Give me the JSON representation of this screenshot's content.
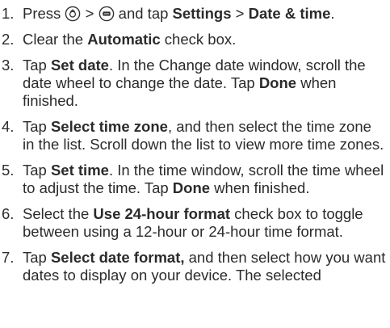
{
  "steps": [
    {
      "num": "1.",
      "parts": [
        "Press ",
        " > ",
        " and tap ",
        "Settings",
        " > ",
        "Date & time",
        "."
      ],
      "icons": [
        "home-icon",
        "menu-icon"
      ]
    },
    {
      "num": "2.",
      "parts": [
        "Clear the ",
        "Automatic",
        " check box."
      ]
    },
    {
      "num": "3.",
      "parts": [
        "Tap ",
        "Set date",
        ". In the Change date window, scroll the date wheel to change the date. Tap ",
        "Done",
        " when finished."
      ]
    },
    {
      "num": "4.",
      "parts": [
        "Tap ",
        "Select time zone",
        ", and then select the time zone in the list. Scroll down the list to view more time zones."
      ]
    },
    {
      "num": "5.",
      "parts": [
        "Tap ",
        "Set time",
        ". In the time window, scroll the time wheel to adjust the time. Tap ",
        "Done",
        " when finished."
      ]
    },
    {
      "num": "6.",
      "parts": [
        "Select the ",
        "Use 24-hour format",
        " check box to toggle between using a 12-hour or 24-hour time format."
      ]
    },
    {
      "num": "7.",
      "parts": [
        "Tap ",
        "Select date format,",
        " and then select how you want dates to display on your device. The selected"
      ]
    }
  ]
}
